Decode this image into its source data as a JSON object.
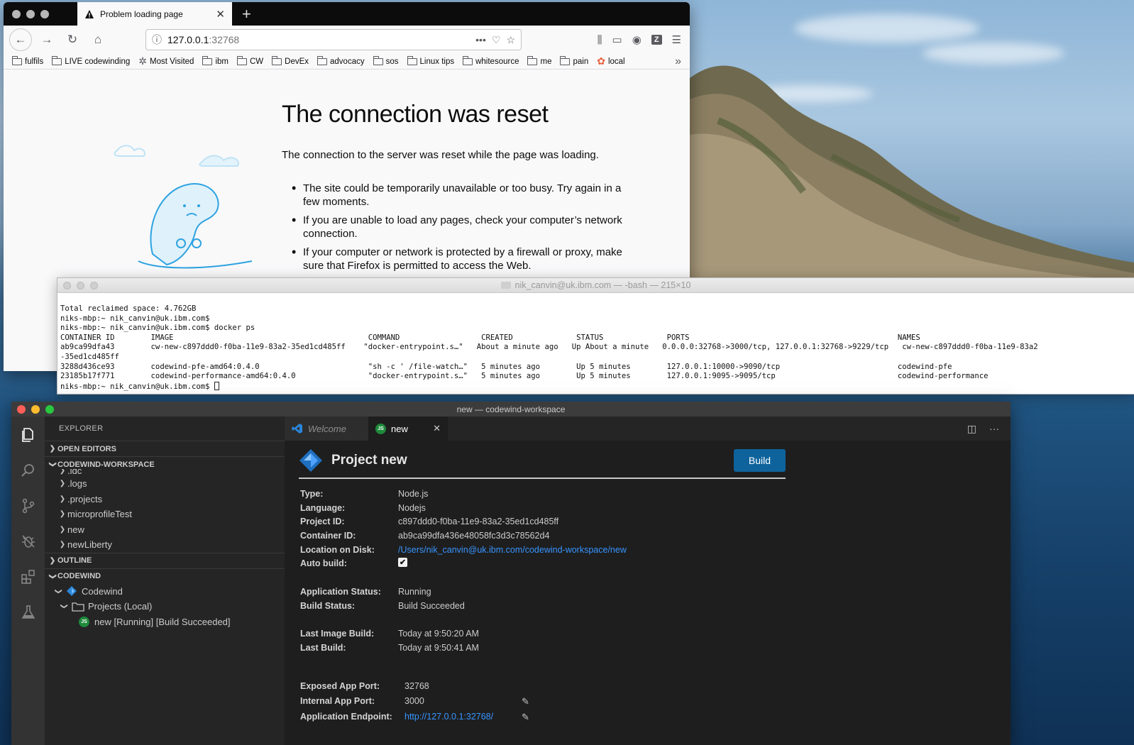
{
  "firefox": {
    "tab_title": "Problem loading page",
    "url_host": "127.0.0.1",
    "url_port": ":32768",
    "bookmarks": [
      {
        "label": "fulfils",
        "icon": "folder-icon"
      },
      {
        "label": "LIVE codewinding",
        "icon": "folder-icon"
      },
      {
        "label": "Most Visited",
        "icon": "gear-icon"
      },
      {
        "label": "ibm",
        "icon": "folder-icon"
      },
      {
        "label": "CW",
        "icon": "folder-icon"
      },
      {
        "label": "DevEx",
        "icon": "folder-icon"
      },
      {
        "label": "advocacy",
        "icon": "folder-icon"
      },
      {
        "label": "sos",
        "icon": "folder-icon"
      },
      {
        "label": "Linux tips",
        "icon": "folder-icon"
      },
      {
        "label": "whitesource",
        "icon": "folder-icon"
      },
      {
        "label": "me",
        "icon": "folder-icon"
      },
      {
        "label": "pain",
        "icon": "folder-icon"
      },
      {
        "label": "local",
        "icon": "flower-icon"
      }
    ],
    "error": {
      "title": "The connection was reset",
      "description": "The connection to the server was reset while the page was loading.",
      "bullets": [
        "The site could be temporarily unavailable or too busy. Try again in a few moments.",
        "If you are unable to load any pages, check your computer’s network connection.",
        "If your computer or network is protected by a firewall or proxy, make sure that Firefox is permitted to access the Web."
      ]
    }
  },
  "terminal": {
    "title": "nik_canvin@uk.ibm.com — -bash — 215×10",
    "lines": [
      "Total reclaimed space: 4.762GB",
      "niks-mbp:~ nik_canvin@uk.ibm.com$",
      "niks-mbp:~ nik_canvin@uk.ibm.com$ docker ps",
      "CONTAINER ID        IMAGE                                           COMMAND                  CREATED              STATUS              PORTS                                              NAMES",
      "ab9ca99dfa43        cw-new-c897ddd0-f0ba-11e9-83a2-35ed1cd485ff    \"docker-entrypoint.s…\"   About a minute ago   Up About a minute   0.0.0.0:32768->3000/tcp, 127.0.0.1:32768->9229/tcp   cw-new-c897ddd0-f0ba-11e9-83a2",
      "-35ed1cd485ff",
      "3288d436ce93        codewind-pfe-amd64:0.4.0                        \"sh -c ' /file-watch…\"   5 minutes ago        Up 5 minutes        127.0.0.1:10000->9090/tcp                          codewind-pfe",
      "23185b17f771        codewind-performance-amd64:0.4.0                \"docker-entrypoint.s…\"   5 minutes ago        Up 5 minutes        127.0.0.1:9095->9095/tcp                           codewind-performance"
    ],
    "prompt": "niks-mbp:~ nik_canvin@uk.ibm.com$ "
  },
  "vscode": {
    "title": "new — codewind-workspace",
    "explorer_label": "EXPLORER",
    "sections": {
      "open_editors": "OPEN EDITORS",
      "workspace": "CODEWIND-WORKSPACE",
      "outline": "OUTLINE",
      "codewind": "CODEWIND"
    },
    "folders": [
      ".idc",
      ".logs",
      ".projects",
      "microprofileTest",
      "new",
      "newLiberty"
    ],
    "codewind_tree": {
      "root": "Codewind",
      "projects": "Projects (Local)",
      "project": "new [Running] [Build Succeeded]",
      "badge": "JS"
    },
    "tabs": {
      "welcome": "Welcome",
      "new": "new"
    },
    "project": {
      "title": "Project new",
      "build_label": "Build",
      "fields": [
        {
          "label": "Type:",
          "value": "Node.js"
        },
        {
          "label": "Language:",
          "value": "Nodejs"
        },
        {
          "label": "Project ID:",
          "value": "c897ddd0-f0ba-11e9-83a2-35ed1cd485ff"
        },
        {
          "label": "Container ID:",
          "value": "ab9ca99dfa436e48058fc3d3c78562d4"
        },
        {
          "label": "Location on Disk:",
          "value": "/Users/nik_canvin@uk.ibm.com/codewind-workspace/new"
        },
        {
          "label": "Auto build:",
          "value": "✔"
        },
        {
          "label": "Application Status:",
          "value": "Running"
        },
        {
          "label": "Build Status:",
          "value": "Build Succeeded"
        },
        {
          "label": "Last Image Build:",
          "value": "Today at 9:50:20 AM"
        },
        {
          "label": "Last Build:",
          "value": "Today at 9:50:41 AM"
        },
        {
          "label": "Exposed App Port:",
          "value": "32768"
        },
        {
          "label": "Internal App Port:",
          "value": "3000"
        },
        {
          "label": "Application Endpoint:",
          "value": "http://127.0.0.1:32768/"
        }
      ]
    }
  }
}
